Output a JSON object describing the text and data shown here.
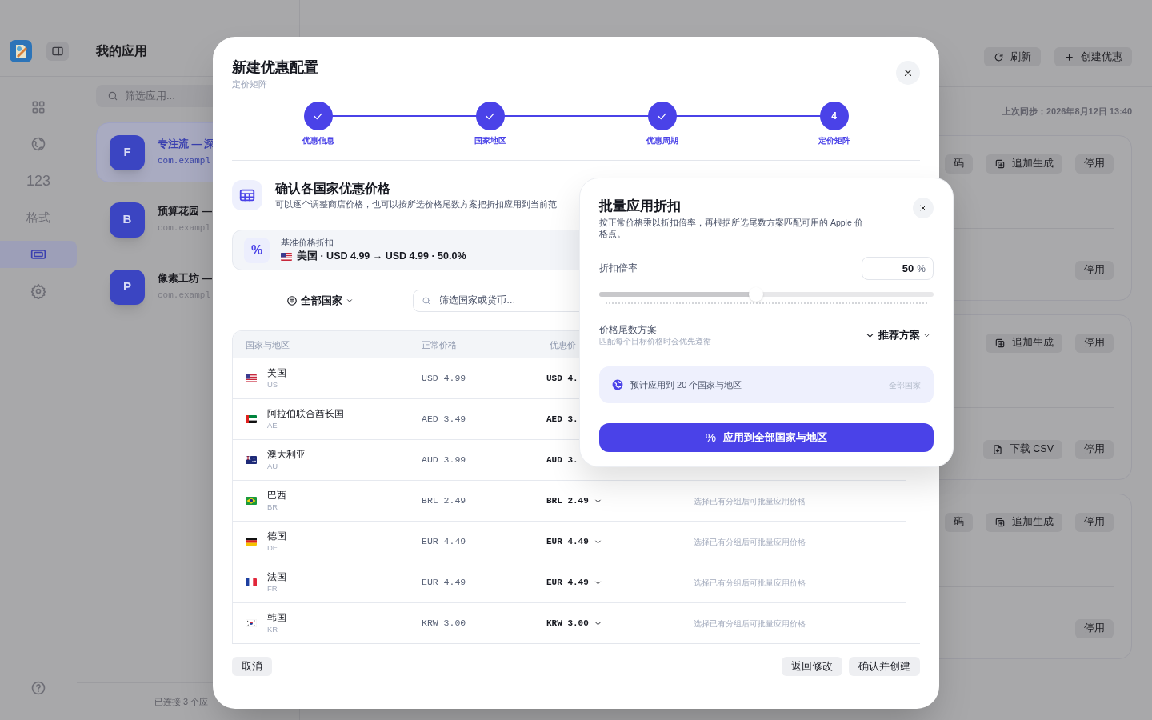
{
  "app": {
    "title": "我的应用",
    "rail": [
      {
        "kind": "grid",
        "selected": false
      },
      {
        "kind": "globe",
        "selected": false
      },
      {
        "kind": "text",
        "label": "123",
        "selected": false
      },
      {
        "kind": "text",
        "label": "格式",
        "selected": false
      },
      {
        "kind": "ticket",
        "selected": true
      },
      {
        "kind": "gear",
        "selected": false
      }
    ],
    "search": {
      "placeholder": "筛选应用..."
    },
    "apps": [
      {
        "initial": "F",
        "name": "专注流 — 深",
        "bundle": "com.exampl",
        "selected": true
      },
      {
        "initial": "B",
        "name": "预算花园 —",
        "bundle": "com.exampl",
        "selected": false
      },
      {
        "initial": "P",
        "name": "像素工坊 —",
        "bundle": "com.exampl",
        "selected": false
      }
    ],
    "footer": "已连接 3 个应",
    "toolbar": [
      {
        "kind": "refresh",
        "label": "刷新"
      },
      {
        "kind": "plus",
        "label": "创建优惠"
      }
    ],
    "last_sync": "上次同步：2026年8月12日 13:40",
    "cards": [
      {
        "rows": [
          {
            "buttons": [
              {
                "kind": "plain",
                "label": "码"
              },
              {
                "kind": "copy",
                "label": "追加生成"
              },
              {
                "kind": "plain",
                "label": "停用"
              }
            ]
          },
          {
            "buttons": [
              {
                "kind": "plain",
                "label": "停用"
              }
            ]
          }
        ]
      },
      {
        "rows": [
          {
            "buttons": [
              {
                "kind": "copy",
                "label": "追加生成"
              },
              {
                "kind": "plain",
                "label": "停用"
              }
            ]
          },
          {
            "buttons": [
              {
                "kind": "download",
                "label": "下载 CSV"
              },
              {
                "kind": "plain",
                "label": "停用"
              }
            ]
          }
        ]
      },
      {
        "rows": [
          {
            "buttons": [
              {
                "kind": "plain",
                "label": "码"
              },
              {
                "kind": "copy",
                "label": "追加生成"
              },
              {
                "kind": "plain",
                "label": "停用"
              }
            ]
          },
          {
            "buttons": [
              {
                "kind": "plain",
                "label": "停用"
              }
            ]
          }
        ]
      }
    ]
  },
  "modal": {
    "title": "新建优惠配置",
    "subtitle": "定价矩阵",
    "steps": [
      {
        "label": "优惠信息",
        "done": true
      },
      {
        "label": "国家地区",
        "done": true
      },
      {
        "label": "优惠周期",
        "done": true
      },
      {
        "label": "定价矩阵",
        "done": false,
        "number": "4"
      }
    ],
    "section": {
      "title": "确认各国家优惠价格",
      "description": "可以逐个调整商店价格，也可以按所选价格尾数方案把折扣应用到当前范"
    },
    "base": {
      "icon_text": "%",
      "label": "基准价格折扣",
      "kind": "us",
      "value": "美国 · USD 4.99 → USD 4.99 · 50.0%"
    },
    "filter": {
      "label": "全部国家"
    },
    "search": {
      "placeholder": "筛选国家或货币…"
    },
    "table": {
      "columns": [
        "国家与地区",
        "正常价格",
        "优惠价"
      ],
      "rows": [
        {
          "kind": "us",
          "name": "美国",
          "code": "US",
          "regular": "USD 4.99",
          "discount": "USD 4.",
          "menu": false
        },
        {
          "kind": "ae",
          "name": "阿拉伯联合酋长国",
          "code": "AE",
          "regular": "AED 3.49",
          "discount": "AED 3.",
          "menu": false
        },
        {
          "kind": "au",
          "name": "澳大利亚",
          "code": "AU",
          "regular": "AUD 3.99",
          "discount": "AUD 3.",
          "menu": false
        },
        {
          "kind": "br",
          "name": "巴西",
          "code": "BR",
          "regular": "BRL 2.49",
          "discount": "BRL 2.49",
          "menu": true,
          "note": "选择已有分组后可批量应用价格"
        },
        {
          "kind": "de",
          "name": "德国",
          "code": "DE",
          "regular": "EUR 4.49",
          "discount": "EUR 4.49",
          "menu": true,
          "note": "选择已有分组后可批量应用价格"
        },
        {
          "kind": "fr",
          "name": "法国",
          "code": "FR",
          "regular": "EUR 4.49",
          "discount": "EUR 4.49",
          "menu": true,
          "note": "选择已有分组后可批量应用价格"
        },
        {
          "kind": "kr",
          "name": "韩国",
          "code": "KR",
          "regular": "KRW 3.00",
          "discount": "KRW 3.00",
          "menu": true,
          "note": "选择已有分组后可批量应用价格"
        }
      ]
    },
    "buttons": {
      "cancel": "取消",
      "back": "返回修改",
      "confirm": "确认并创建"
    }
  },
  "popover": {
    "title": "批量应用折扣",
    "description": "按正常价格乘以折扣倍率，再根据所选尾数方案匹配可用的 Apple 价格点。",
    "rate_label": "折扣倍率",
    "rate_value": "50",
    "rate_unit": "%",
    "level": 0.47,
    "rounding_label": "价格尾数方案",
    "rounding_hint": "匹配每个目标价格时会优先遵循",
    "rounding_value": "推荐方案",
    "scope_text": "预计应用到 20 个国家与地区",
    "scope_tag": "全部国家",
    "apply_icon": "%",
    "apply_label": "应用到全部国家与地区"
  }
}
